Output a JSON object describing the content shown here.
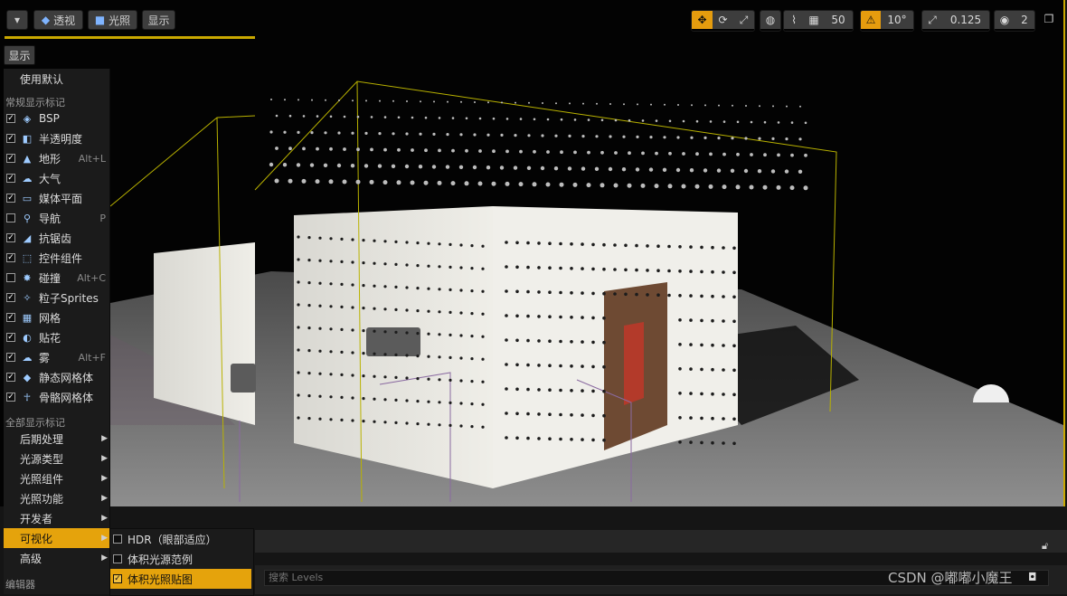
{
  "toolbar": {
    "perspective_label": "透视",
    "lighting_label": "光照",
    "show_label": "显示",
    "grid_snap_value": "50",
    "rotation_snap_value": "10°",
    "scale_snap_value": "0.125",
    "camera_speed_value": "2"
  },
  "show_menu": {
    "title_button": "显示",
    "use_defaults": "使用默认",
    "common_section": "常规显示标记",
    "common_items": [
      {
        "label": "BSP",
        "checked": true,
        "icon": "bsp-icon",
        "shortcut": ""
      },
      {
        "label": "半透明度",
        "checked": true,
        "icon": "translucency-icon",
        "shortcut": ""
      },
      {
        "label": "地形",
        "checked": true,
        "icon": "landscape-icon",
        "shortcut": "Alt+L"
      },
      {
        "label": "大气",
        "checked": true,
        "icon": "atmosphere-icon",
        "shortcut": ""
      },
      {
        "label": "媒体平面",
        "checked": true,
        "icon": "media-plane-icon",
        "shortcut": ""
      },
      {
        "label": "导航",
        "checked": false,
        "icon": "navigation-icon",
        "shortcut": "P"
      },
      {
        "label": "抗锯齿",
        "checked": true,
        "icon": "anti-aliasing-icon",
        "shortcut": ""
      },
      {
        "label": "控件组件",
        "checked": true,
        "icon": "widget-component-icon",
        "shortcut": ""
      },
      {
        "label": "碰撞",
        "checked": false,
        "icon": "collision-icon",
        "shortcut": "Alt+C"
      },
      {
        "label": "粒子Sprites",
        "checked": true,
        "icon": "particle-sprites-icon",
        "shortcut": ""
      },
      {
        "label": "网格",
        "checked": true,
        "icon": "grid-icon",
        "shortcut": ""
      },
      {
        "label": "贴花",
        "checked": true,
        "icon": "decal-icon",
        "shortcut": ""
      },
      {
        "label": "雾",
        "checked": true,
        "icon": "fog-icon",
        "shortcut": "Alt+F"
      },
      {
        "label": "静态网格体",
        "checked": true,
        "icon": "static-mesh-icon",
        "shortcut": ""
      },
      {
        "label": "骨骼网格体",
        "checked": true,
        "icon": "skeletal-mesh-icon",
        "shortcut": ""
      }
    ],
    "all_section": "全部显示标记",
    "all_items": [
      {
        "label": "后期处理"
      },
      {
        "label": "光源类型"
      },
      {
        "label": "光照组件"
      },
      {
        "label": "光照功能"
      },
      {
        "label": "开发者"
      },
      {
        "label": "可视化"
      },
      {
        "label": "高级"
      }
    ],
    "editor_section": "编辑器"
  },
  "visualize_submenu": {
    "items": [
      {
        "label": "HDR（眼部适应）",
        "checked": false
      },
      {
        "label": "体积光源范例",
        "checked": false
      },
      {
        "label": "体积光照贴图",
        "checked": true
      }
    ]
  },
  "levels_panel": {
    "search_placeholder": "搜索 Levels"
  },
  "watermark": "CSDN @嘟嘟小魔王",
  "colors": {
    "accent": "#e5a30c",
    "selection_outline": "#c9a800",
    "viewport_bg": "#030303",
    "menu_bg": "#1b1b1b"
  }
}
